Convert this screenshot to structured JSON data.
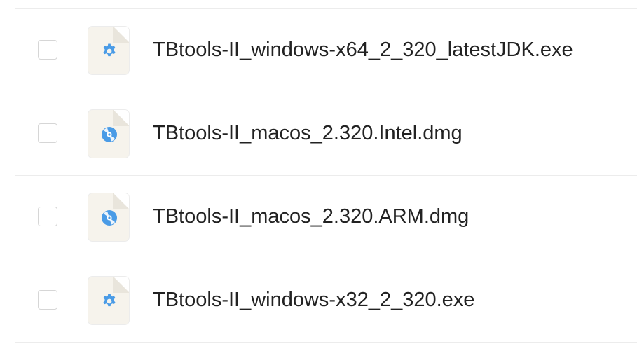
{
  "files": [
    {
      "name": "TBtools-II_windows-x64_2_320_latestJDK.exe",
      "icon": "gear-icon",
      "checked": false
    },
    {
      "name": "TBtools-II_macos_2.320.Intel.dmg",
      "icon": "disc-icon",
      "checked": false
    },
    {
      "name": "TBtools-II_macos_2.320.ARM.dmg",
      "icon": "disc-icon",
      "checked": false
    },
    {
      "name": "TBtools-II_windows-x32_2_320.exe",
      "icon": "gear-icon",
      "checked": false
    }
  ],
  "colors": {
    "icon_blue": "#4a9be6",
    "thumb_bg": "#f6f3ec",
    "text": "#222222",
    "divider": "#ececec"
  }
}
